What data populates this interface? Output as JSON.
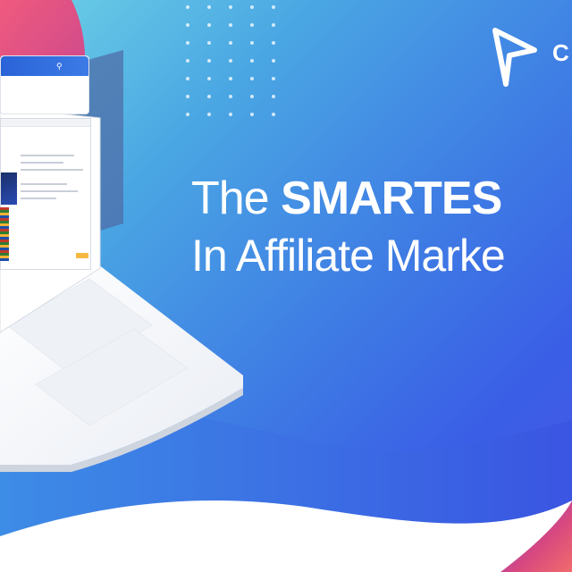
{
  "headline": {
    "line1_light": "The ",
    "line1_bold": "SMARTES",
    "line2": "In Affiliate Marke"
  },
  "logo": {
    "letter": "C",
    "icon": "arrow-cursor-logo-icon"
  },
  "colors": {
    "bg_start": "#6fd3e6",
    "bg_mid": "#3f7fe4",
    "bg_end": "#4a58e8",
    "accent_pink": "#e0457b",
    "text": "#ffffff",
    "cta_button": "#f5b942"
  },
  "icons": [
    "search-icon",
    "arrow-cursor-logo-icon",
    "laptop-icon"
  ]
}
